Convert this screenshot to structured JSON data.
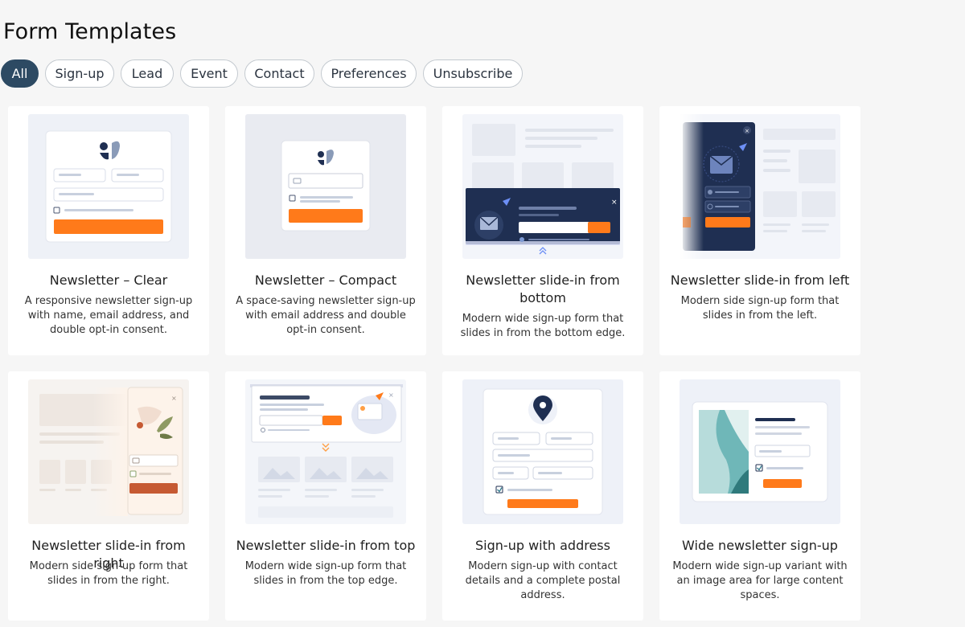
{
  "page": {
    "title": "Form Templates"
  },
  "filters": [
    {
      "label": "All",
      "active": true
    },
    {
      "label": "Sign-up",
      "active": false
    },
    {
      "label": "Lead",
      "active": false
    },
    {
      "label": "Event",
      "active": false
    },
    {
      "label": "Contact",
      "active": false
    },
    {
      "label": "Preferences",
      "active": false
    },
    {
      "label": "Unsubscribe",
      "active": false
    }
  ],
  "templates": [
    {
      "title": "Newsletter – Clear",
      "description": "A responsive newsletter sign-up with name, email address, and double opt-in consent.",
      "thumbnail": "newsletter-clear-preview"
    },
    {
      "title": "Newsletter – Compact",
      "description": "A space-saving newsletter sign-up with email address and double opt-in consent.",
      "thumbnail": "newsletter-compact-preview"
    },
    {
      "title": "Newsletter slide-in from bottom",
      "description": "Modern wide sign-up form that slides in from the bottom edge.",
      "thumbnail": "slide-in-bottom-preview"
    },
    {
      "title": "Newsletter slide-in from left",
      "description": "Modern side sign-up form that slides in from the left.",
      "thumbnail": "slide-in-left-preview"
    },
    {
      "title": "Newsletter slide-in from right",
      "description": "Modern side sign-up form that slides in from the right.",
      "thumbnail": "slide-in-right-preview"
    },
    {
      "title": "Newsletter slide-in from top",
      "description": "Modern wide sign-up form that slides in from the top edge.",
      "thumbnail": "slide-in-top-preview"
    },
    {
      "title": "Sign-up with address",
      "description": "Modern sign-up with contact details and a complete postal address.",
      "thumbnail": "signup-address-preview"
    },
    {
      "title": "Wide newsletter sign-up",
      "description": "Modern wide sign-up variant with an image area for large content spaces.",
      "thumbnail": "wide-newsletter-preview"
    }
  ],
  "colors": {
    "accent": "#ff7a1a",
    "navy": "#1f2f52",
    "active_chip": "#2d4a63",
    "teal": "#6fb7b8"
  }
}
